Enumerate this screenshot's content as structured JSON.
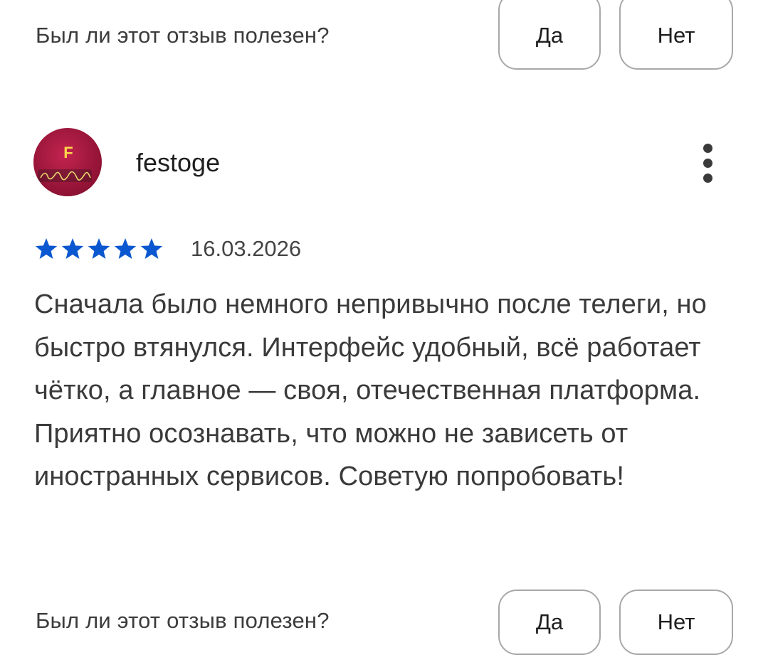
{
  "top_helpful": {
    "question": "Был ли этот отзыв полезен?",
    "yes_label": "Да",
    "no_label": "Нет"
  },
  "review": {
    "avatar_letter": "F",
    "author": "festoge",
    "rating": 5,
    "date": "16.03.2026",
    "text": "Сначала было немного непривычно после телеги, но быстро втянулся. Интерфейс удобный, всё работает чётко, а главное — своя, отечественная платформа. Приятно осознавать, что можно не зависеть от иностранных сервисов. Советую попробовать!",
    "star_color": "#0b57d0"
  },
  "bottom_helpful": {
    "question": "Был ли этот отзыв полезен?",
    "yes_label": "Да",
    "no_label": "Нет"
  }
}
